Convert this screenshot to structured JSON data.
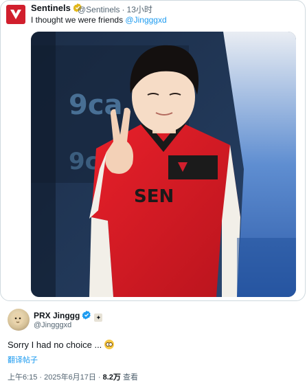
{
  "quoted_post": {
    "author_name": "Sentinels",
    "handle": "@Sentinels",
    "time": "13小时",
    "text": "I thought we were friends ",
    "mention": "@Jingggxd",
    "photo": {
      "jersey_text": "SEN",
      "background_text": "9ca."
    }
  },
  "post": {
    "author_name": "PRX Jinggg",
    "handle": "@Jingggxd",
    "text": "Sorry I had no choice ...",
    "translate_label": "翻译帖子",
    "time": "上午6:15",
    "date": "2025年6月17日",
    "views_count": "8.2万",
    "views_label": "查看"
  },
  "colors": {
    "brand_red": "#d11f2d",
    "link_blue": "#1d9bf0",
    "muted": "#536471"
  },
  "icons": [
    "sentinels-logo-icon",
    "verified-icon",
    "affiliate-badge-icon",
    "pleading-face-emoji-icon"
  ]
}
